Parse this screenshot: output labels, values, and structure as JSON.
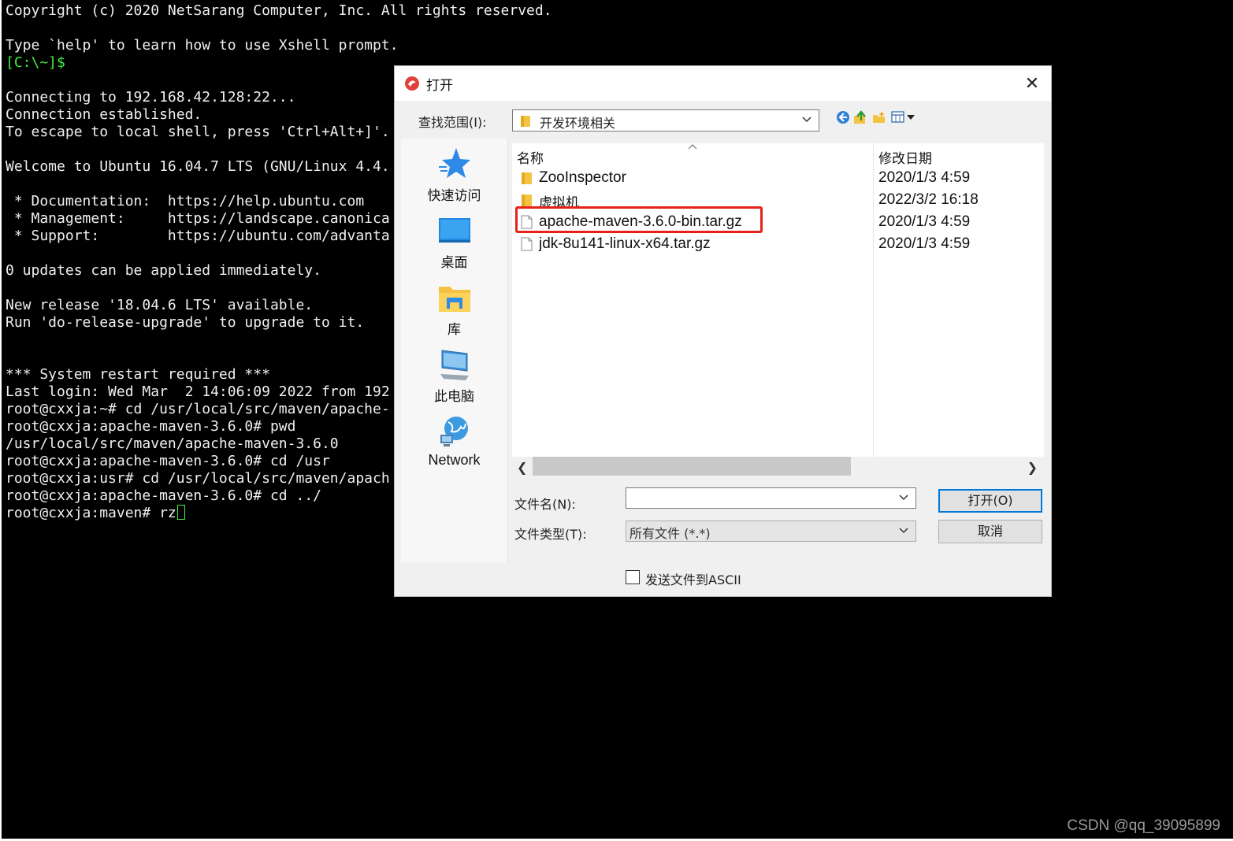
{
  "terminal": {
    "lines": [
      {
        "text": "Copyright (c) 2020 NetSarang Computer, Inc. All rights reserved.",
        "color": "normal"
      },
      {
        "text": "",
        "color": "normal"
      },
      {
        "text": "Type `help' to learn how to use Xshell prompt.",
        "color": "normal"
      },
      {
        "text": "[C:\\~]$",
        "color": "green"
      },
      {
        "text": "",
        "color": "normal"
      },
      {
        "text": "Connecting to 192.168.42.128:22...",
        "color": "normal"
      },
      {
        "text": "Connection established.",
        "color": "normal"
      },
      {
        "text": "To escape to local shell, press 'Ctrl+Alt+]'.",
        "color": "normal"
      },
      {
        "text": "",
        "color": "normal"
      },
      {
        "text": "Welcome to Ubuntu 16.04.7 LTS (GNU/Linux 4.4.",
        "color": "normal"
      },
      {
        "text": "",
        "color": "normal"
      },
      {
        "text": " * Documentation:  https://help.ubuntu.com",
        "color": "normal"
      },
      {
        "text": " * Management:     https://landscape.canonica",
        "color": "normal"
      },
      {
        "text": " * Support:        https://ubuntu.com/advanta",
        "color": "normal"
      },
      {
        "text": "",
        "color": "normal"
      },
      {
        "text": "0 updates can be applied immediately.",
        "color": "normal"
      },
      {
        "text": "",
        "color": "normal"
      },
      {
        "text": "New release '18.04.6 LTS' available.",
        "color": "normal"
      },
      {
        "text": "Run 'do-release-upgrade' to upgrade to it.",
        "color": "normal"
      },
      {
        "text": "",
        "color": "normal"
      },
      {
        "text": "",
        "color": "normal"
      },
      {
        "text": "*** System restart required ***",
        "color": "normal"
      },
      {
        "text": "Last login: Wed Mar  2 14:06:09 2022 from 192",
        "color": "normal"
      },
      {
        "text": "root@cxxja:~# cd /usr/local/src/maven/apache-",
        "color": "normal"
      },
      {
        "text": "root@cxxja:apache-maven-3.6.0# pwd",
        "color": "normal"
      },
      {
        "text": "/usr/local/src/maven/apache-maven-3.6.0",
        "color": "normal"
      },
      {
        "text": "root@cxxja:apache-maven-3.6.0# cd /usr",
        "color": "normal"
      },
      {
        "text": "root@cxxja:usr# cd /usr/local/src/maven/apach",
        "color": "normal"
      },
      {
        "text": "root@cxxja:apache-maven-3.6.0# cd ../",
        "color": "normal"
      },
      {
        "text": "root@cxxja:maven# rz",
        "color": "normal",
        "cursor": true
      }
    ],
    "prompt_color": "#3ff23f",
    "text_color": "#f0f0f0",
    "background": "#000000"
  },
  "dialog": {
    "title": "打开",
    "close_glyph": "✕",
    "look_in_label": "查找范围(I):",
    "look_in_value": "开发环境相关",
    "toolbar_icons": [
      "back-icon",
      "up-folder-icon",
      "new-folder-icon",
      "view-menu-icon"
    ],
    "places": [
      {
        "label": "快速访问",
        "icon": "quick-access-star-icon"
      },
      {
        "label": "桌面",
        "icon": "desktop-icon"
      },
      {
        "label": "库",
        "icon": "libraries-icon"
      },
      {
        "label": "此电脑",
        "icon": "this-pc-icon"
      },
      {
        "label": "Network",
        "icon": "network-icon"
      }
    ],
    "columns": {
      "name": "名称",
      "date": "修改日期"
    },
    "files": [
      {
        "name": "ZooInspector",
        "date": "2020/1/3 4:59",
        "type": "folder",
        "highlighted": false
      },
      {
        "name": "虚拟机",
        "date": "2022/3/2 16:18",
        "type": "folder",
        "highlighted": false
      },
      {
        "name": "apache-maven-3.6.0-bin.tar.gz",
        "date": "2020/1/3 4:59",
        "type": "file",
        "highlighted": true
      },
      {
        "name": "jdk-8u141-linux-x64.tar.gz",
        "date": "2020/1/3 4:59",
        "type": "file",
        "highlighted": false
      }
    ],
    "file_name_label": "文件名(N):",
    "file_name_value": "",
    "file_type_label": "文件类型(T):",
    "file_type_value": "所有文件 (*.*)",
    "open_button": "打开(O)",
    "cancel_button": "取消",
    "ascii_checkbox_label": "发送文件到ASCII",
    "ascii_checked": false,
    "highlight_color": "#e8201a",
    "accent_color": "#0078d7"
  },
  "watermark": "CSDN @qq_39095899"
}
